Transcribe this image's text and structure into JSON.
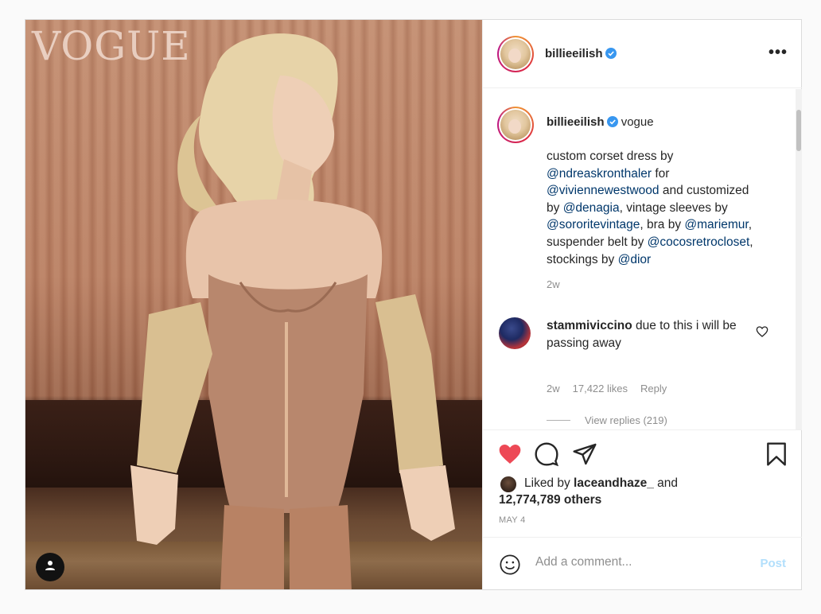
{
  "photo": {
    "magazine_logo": "VOGUE",
    "user_tag_icon": "person-icon"
  },
  "header": {
    "username": "billieeilish",
    "verified": true,
    "more_icon": "ellipsis-icon",
    "more_label": "•••"
  },
  "caption": {
    "username": "billieeilish",
    "text_start": "vogue",
    "lines": [
      {
        "parts": [
          {
            "t": "custom corset dress by",
            "m": false
          }
        ]
      },
      {
        "parts": [
          {
            "t": "@ndreaskronthaler",
            "m": true
          },
          {
            "t": " for",
            "m": false
          }
        ]
      },
      {
        "parts": [
          {
            "t": "@viviennewestwood",
            "m": true
          },
          {
            "t": " and customized",
            "m": false
          }
        ]
      },
      {
        "parts": [
          {
            "t": "by ",
            "m": false
          },
          {
            "t": "@denagia",
            "m": true
          },
          {
            "t": ", vintage sleeves by",
            "m": false
          }
        ]
      },
      {
        "parts": [
          {
            "t": "@sororitevintage",
            "m": true
          },
          {
            "t": ", bra by ",
            "m": false
          },
          {
            "t": "@mariemur",
            "m": true
          },
          {
            "t": ",",
            "m": false
          }
        ]
      },
      {
        "parts": [
          {
            "t": "suspender belt by ",
            "m": false
          },
          {
            "t": "@cocosretrocloset",
            "m": true
          },
          {
            "t": ",",
            "m": false
          }
        ]
      },
      {
        "parts": [
          {
            "t": "stockings by ",
            "m": false
          },
          {
            "t": "@dior",
            "m": true
          }
        ]
      }
    ],
    "age": "2w"
  },
  "comment": {
    "username": "stammiviccino",
    "text": " due to this i will be passing away",
    "age": "2w",
    "likes": "17,422 likes",
    "reply_label": "Reply",
    "view_replies": "View replies (219)"
  },
  "actions": {
    "like_icon": "heart-filled-icon",
    "comment_icon": "comment-icon",
    "share_icon": "paper-plane-icon",
    "save_icon": "bookmark-icon",
    "like_color": "#ed4956"
  },
  "likes": {
    "prefix": "Liked by ",
    "user": "laceandhaze_",
    "mid": " and",
    "count": "12,774,789 others"
  },
  "date": "MAY 4",
  "add_comment": {
    "placeholder": "Add a comment...",
    "post_label": "Post",
    "emoji_icon": "smiley-icon"
  }
}
